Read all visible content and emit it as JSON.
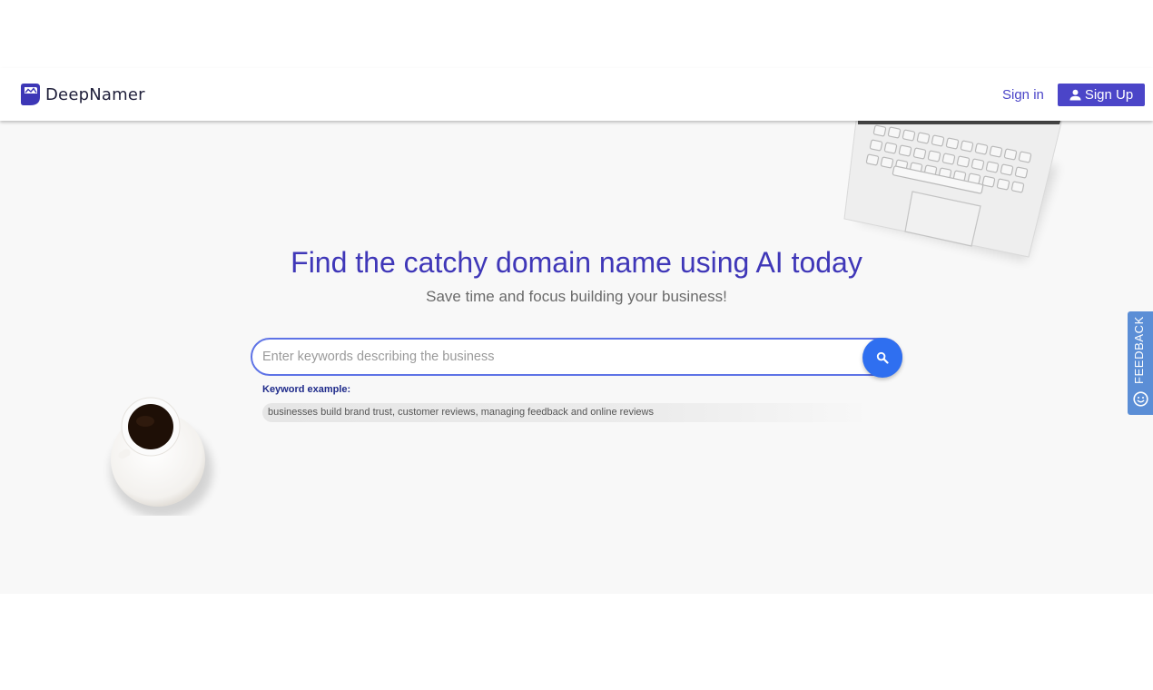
{
  "header": {
    "brand": "DeepNamer",
    "signin_label": "Sign in",
    "signup_label": "Sign Up"
  },
  "hero": {
    "title": "Find the catchy domain name using AI today",
    "subtitle": "Save time and focus building your business!",
    "search": {
      "placeholder": "Enter keywords describing the business",
      "value": ""
    },
    "keyword_label": "Keyword example:",
    "keyword_example": "businesses build brand trust, customer reviews, managing feedback and online reviews"
  },
  "feedback": {
    "label": "FEEDBACK"
  },
  "icons": {
    "logo": "deepnamer-logo-icon",
    "signup": "user-icon",
    "search": "search-icon",
    "feedback": "smile-icon"
  },
  "colors": {
    "brand": "#4b45c8",
    "title": "#3f37b8",
    "search_button": "#2f6ff0",
    "feedback_tab": "#5b8ed6"
  }
}
